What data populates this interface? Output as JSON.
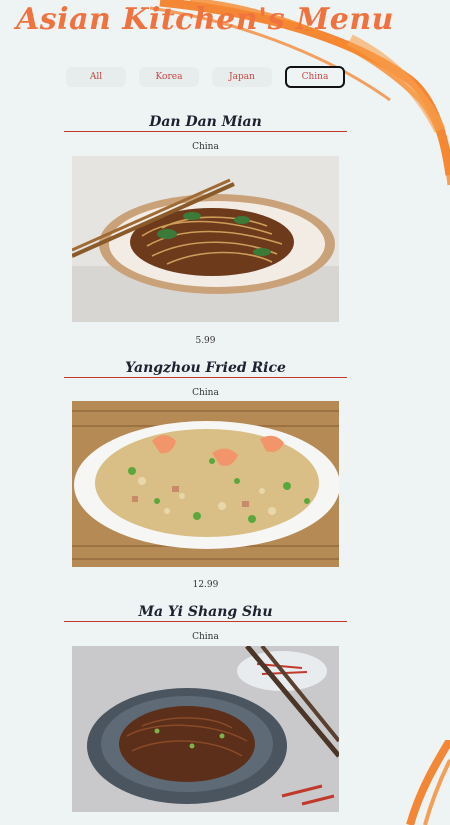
{
  "header": {
    "title": "Asian Kitchen's Menu"
  },
  "filters": [
    {
      "label": "All",
      "active": false
    },
    {
      "label": "Korea",
      "active": false
    },
    {
      "label": "Japan",
      "active": false
    },
    {
      "label": "China",
      "active": true
    }
  ],
  "menu_items": [
    {
      "name": "Dan Dan Mian",
      "origin": "China",
      "price": "5.99"
    },
    {
      "name": "Yangzhou Fried Rice",
      "origin": "China",
      "price": "12.99"
    },
    {
      "name": "Ma Yi Shang Shu",
      "origin": "China",
      "price": ""
    }
  ],
  "colors": {
    "accent": "#f0723e",
    "rule": "#c0392b",
    "background": "#eef3f3",
    "filter_text": "#c94444"
  }
}
